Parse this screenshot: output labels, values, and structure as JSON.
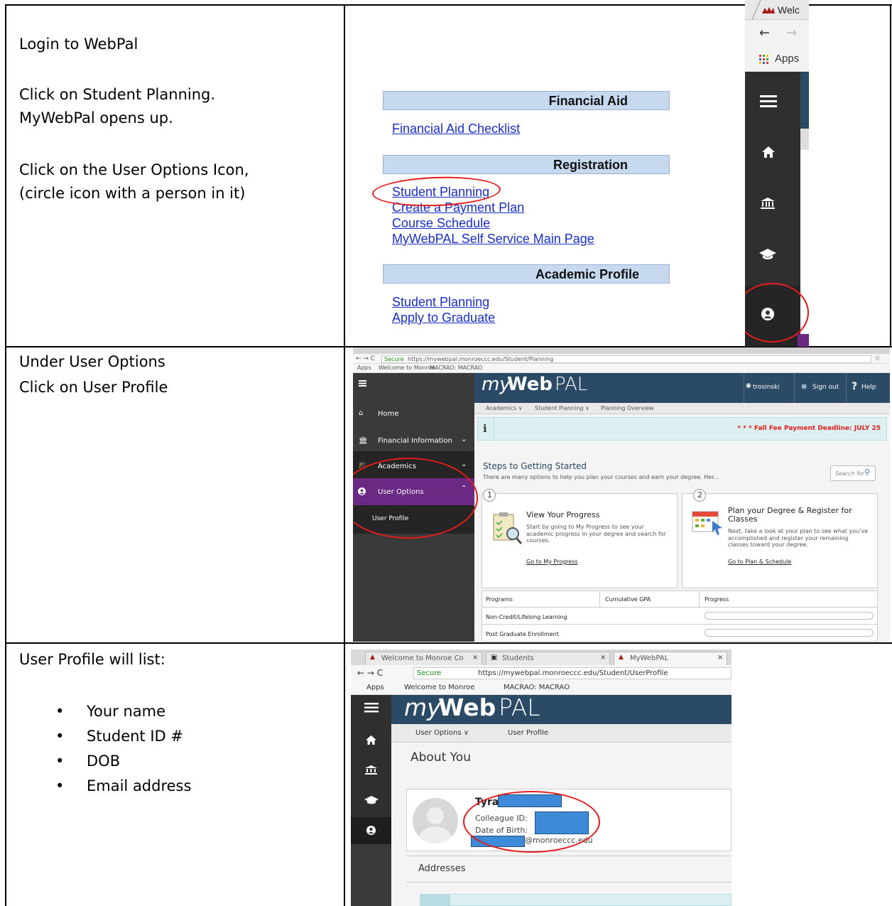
{
  "row1": {
    "step1": "Login to WebPal",
    "step2a": "Click on Student Planning.",
    "step2b": "MyWebPal opens up.",
    "step3a": "Click on the User Options Icon,",
    "step3b": "(circle icon with a person in it)",
    "sections": {
      "financial_aid": "Financial Aid",
      "registration": "Registration",
      "academic_profile": "Academic Profile"
    },
    "links": {
      "fa_checklist": "Financial Aid Checklist",
      "student_planning": "Student Planning",
      "payment_plan": "Create a Payment Plan",
      "course_schedule": "Course Schedule",
      "main_page": "MyWebPAL Self Service Main Page",
      "student_planning_2": "Student Planning",
      "apply_graduate": "Apply to Graduate"
    },
    "browser": {
      "tab": "Welc",
      "apps": "Apps"
    }
  },
  "row2": {
    "line1": "Under User Options",
    "line2": "Click on User Profile",
    "url_secure": "Secure",
    "url": "https://mywebpal.monroeccc.edu/Student/Planning",
    "bookmarks": [
      "Apps",
      "Welcome to Monroe",
      "MACRAO: MACRAO"
    ],
    "logo_my": "my",
    "logo_web": "Web",
    "logo_pal": "PAL",
    "user": "trosinski",
    "sign_out": "Sign out",
    "help": "Help",
    "breadcrumb": [
      "Academics ∨",
      "Student Planning ∨",
      "Planning Overview"
    ],
    "notice": "* * * Fall Fee Payment Deadline: JULY 25",
    "sidebar": [
      "Home",
      "Financial Information",
      "Academics",
      "User Options",
      "User Profile"
    ],
    "steps_title": "Steps to Getting Started",
    "steps_desc": "There are many options to help you plan your courses and earn your degree. Her...",
    "search_placeholder": "Search for",
    "card1": {
      "num": "1",
      "title": "View Your Progress",
      "body": "Start by going to My Progress to see your academic progress in your degree and search for courses.",
      "link": "Go to My Progress"
    },
    "card2": {
      "num": "2",
      "title": "Plan your Degree & Register for Classes",
      "body": "Next, take a look at your plan to see what you've accomplished and register your remaining classes toward your degree.",
      "link": "Go to Plan & Schedule"
    },
    "table_headers": [
      "Programs",
      "Cumulative GPA",
      "Progress"
    ],
    "table_rows": [
      "Non-Credit/Lifelong Learning",
      "Post Graduate Enrollment"
    ]
  },
  "row3": {
    "intro": "User Profile will list:",
    "items": [
      "Your name",
      "Student ID #",
      "DOB",
      "Email address"
    ],
    "tabs": [
      "Welcome to Monroe Co",
      "Students",
      "MyWebPAL"
    ],
    "url_secure": "Secure",
    "url": "https://mywebpal.monroeccc.edu/Student/UserProfile",
    "bookmarks": [
      "Apps",
      "Welcome to Monroe",
      "MACRAO: MACRAO"
    ],
    "breadcrumb": [
      "User Options ∨",
      "User Profile"
    ],
    "about": "About You",
    "name": "Tyra",
    "colleague_id": "Colleague ID:",
    "dob": "Date of Birth:",
    "email_suffix": "@monroeccc.edu",
    "addresses": "Addresses"
  },
  "colors": {
    "red_circle": "#e31b1b",
    "blue_redact": "#3c8ad8",
    "webpal_navy": "#2a4a66",
    "purple": "#6a2a83"
  }
}
